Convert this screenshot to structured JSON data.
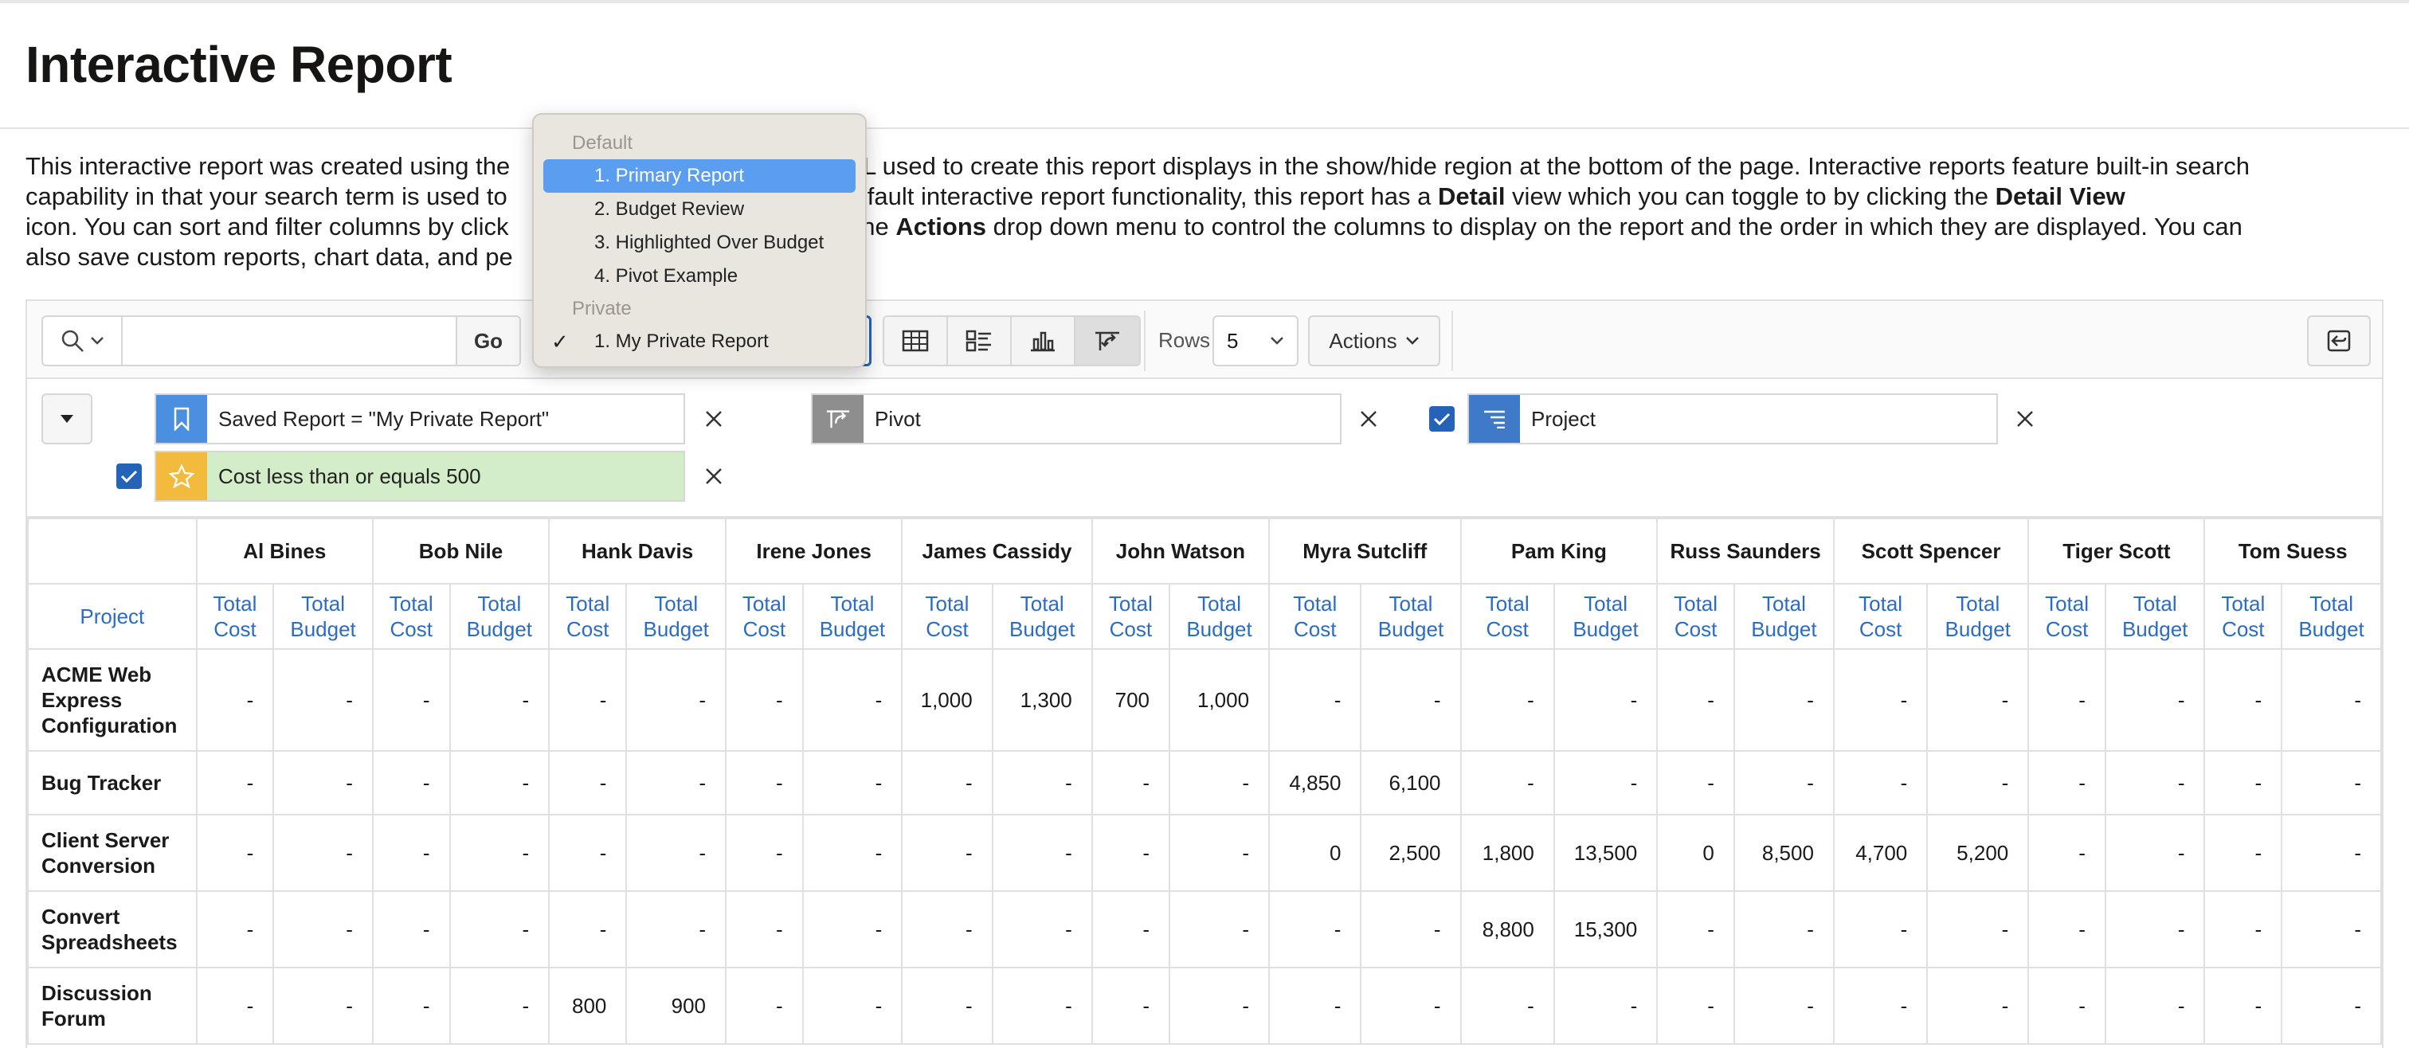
{
  "page": {
    "title": "Interactive Report"
  },
  "description": {
    "line1": "This interactive report was created using the ",
    "line1b": "QL used to create this report displays in the show/hide region at the bottom of the page. Interactive reports feature built-in search",
    "line2a": "capability in that your search term is used to ",
    "line2b": "dition to the default interactive report functionality, this report has a ",
    "line2_bold1": "Detail",
    "line2c": " view which you can toggle to by clicking the ",
    "line2_bold2": "Detail View",
    "line3a": "icon. You can sort and filter columns by click",
    "line3b": "k the ",
    "line3_bold": "Actions",
    "line3c": " drop down menu to control the columns to display on the report and the order in which they are displayed. You can",
    "line4a": "also save custom reports, chart data, and pe"
  },
  "toolbar": {
    "search_placeholder": "",
    "go_label": "Go",
    "rows_label": "Rows",
    "rows_value": "5",
    "actions_label": "Actions"
  },
  "dropdown": {
    "group_default": "Default",
    "items_default": [
      "1. Primary Report",
      "2. Budget Review",
      "3. Highlighted Over Budget",
      "4. Pivot Example"
    ],
    "group_private": "Private",
    "items_private": [
      "1. My Private Report"
    ]
  },
  "filters": {
    "saved_report": "Saved Report = \"My Private Report\"",
    "pivot": "Pivot",
    "project": "Project",
    "highlight": "Cost less than or equals 500"
  },
  "table": {
    "people": [
      "Al Bines",
      "Bob Nile",
      "Hank Davis",
      "Irene Jones",
      "James Cassidy",
      "John Watson",
      "Myra Sutcliff",
      "Pam King",
      "Russ Saunders",
      "Scott Spencer",
      "Tiger Scott",
      "Tom Suess"
    ],
    "project_label": "Project",
    "cost_label": "Total Cost",
    "budget_label": "Total Budget",
    "rows": [
      {
        "name": "ACME Web Express Configuration",
        "values": [
          "-",
          "-",
          "-",
          "-",
          "-",
          "-",
          "-",
          "-",
          "1,000",
          "1,300",
          "700",
          "1,000",
          "-",
          "-",
          "-",
          "-",
          "-",
          "-",
          "-",
          "-",
          "-",
          "-",
          "-",
          "-"
        ]
      },
      {
        "name": "Bug Tracker",
        "values": [
          "-",
          "-",
          "-",
          "-",
          "-",
          "-",
          "-",
          "-",
          "-",
          "-",
          "-",
          "-",
          "4,850",
          "6,100",
          "-",
          "-",
          "-",
          "-",
          "-",
          "-",
          "-",
          "-",
          "-",
          "-"
        ]
      },
      {
        "name": "Client Server Conversion",
        "values": [
          "-",
          "-",
          "-",
          "-",
          "-",
          "-",
          "-",
          "-",
          "-",
          "-",
          "-",
          "-",
          "0",
          "2,500",
          "1,800",
          "13,500",
          "0",
          "8,500",
          "4,700",
          "5,200",
          "-",
          "-",
          "-",
          "-"
        ]
      },
      {
        "name": "Convert Spreadsheets",
        "values": [
          "-",
          "-",
          "-",
          "-",
          "-",
          "-",
          "-",
          "-",
          "-",
          "-",
          "-",
          "-",
          "-",
          "-",
          "8,800",
          "15,300",
          "-",
          "-",
          "-",
          "-",
          "-",
          "-",
          "-",
          "-"
        ]
      },
      {
        "name": "Discussion Forum",
        "values": [
          "-",
          "-",
          "-",
          "-",
          "800",
          "900",
          "-",
          "-",
          "-",
          "-",
          "-",
          "-",
          "-",
          "-",
          "-",
          "-",
          "-",
          "-",
          "-",
          "-",
          "-",
          "-",
          "-",
          "-"
        ]
      }
    ]
  },
  "colors": {
    "accent": "#2563b8",
    "link": "#2b6cc4",
    "highlight_bg": "#d4edc9",
    "star_bg": "#f2bb3d"
  }
}
